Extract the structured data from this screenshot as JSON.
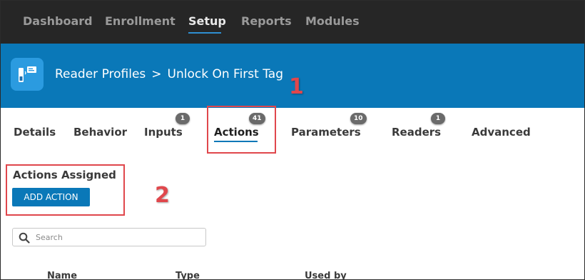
{
  "topnav": {
    "items": [
      {
        "label": "Dashboard"
      },
      {
        "label": "Enrollment"
      },
      {
        "label": "Setup"
      },
      {
        "label": "Reports"
      },
      {
        "label": "Modules"
      }
    ],
    "active": "Setup"
  },
  "header": {
    "icon": "reader-device-icon",
    "breadcrumb": {
      "parent": "Reader Profiles",
      "separator": ">",
      "current": "Unlock On First Tag"
    }
  },
  "tabs": [
    {
      "label": "Details",
      "badge": ""
    },
    {
      "label": "Behavior",
      "badge": ""
    },
    {
      "label": "Inputs",
      "badge": "1"
    },
    {
      "label": "Actions",
      "badge": "41"
    },
    {
      "label": "Parameters",
      "badge": "10"
    },
    {
      "label": "Readers",
      "badge": "1"
    },
    {
      "label": "Advanced",
      "badge": ""
    }
  ],
  "active_tab": "Actions",
  "annotations": {
    "first": "1",
    "second": "2"
  },
  "actions_section": {
    "title": "Actions Assigned",
    "add_button": "ADD ACTION",
    "search_placeholder": "Search"
  },
  "table": {
    "columns": [
      "Name",
      "Type",
      "Used by"
    ]
  },
  "colors": {
    "topnav_bg": "#262626",
    "header_bg": "#0a78b8",
    "accent": "#0a78b8",
    "annotation_red": "#e0474c"
  }
}
